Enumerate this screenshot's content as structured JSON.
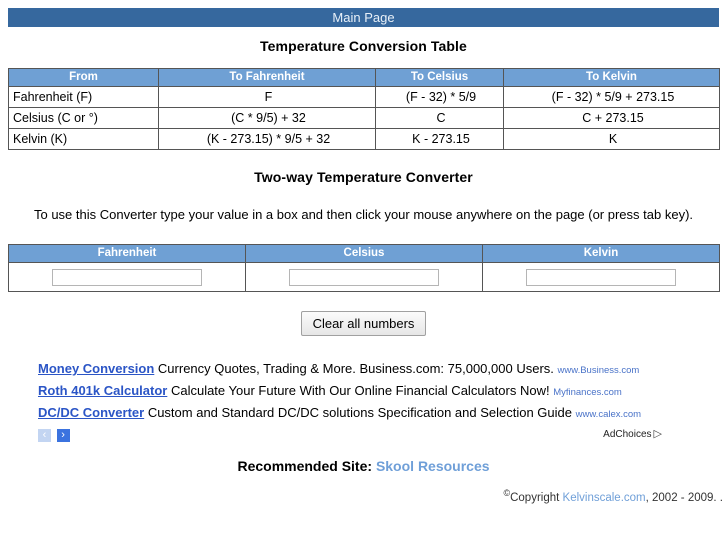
{
  "header": {
    "main_page_label": "Main Page",
    "bar_color": "#36689e"
  },
  "titles": {
    "conversion_table": "Temperature Conversion Table",
    "converter": "Two-way Temperature Converter"
  },
  "conversion_table": {
    "header_color": "#6fa0d4",
    "columns": [
      "From",
      "To Fahrenheit",
      "To Celsius",
      "To Kelvin"
    ],
    "rows": [
      {
        "from": "Fahrenheit (F)",
        "to_fahrenheit": "F",
        "to_celsius": "(F - 32) * 5/9",
        "to_kelvin": "(F - 32) * 5/9 + 273.15"
      },
      {
        "from": "Celsius (C or °)",
        "to_fahrenheit": "(C * 9/5) + 32",
        "to_celsius": "C",
        "to_kelvin": "C + 273.15"
      },
      {
        "from": "Kelvin (K)",
        "to_fahrenheit": "(K - 273.15) * 9/5 + 32",
        "to_celsius": "K - 273.15",
        "to_kelvin": "K"
      }
    ]
  },
  "converter": {
    "instruction": "To use this Converter type your value in a box and then click your mouse anywhere on the page (or press tab key).",
    "columns": [
      "Fahrenheit",
      "Celsius",
      "Kelvin"
    ],
    "fields": [
      {
        "label": "Fahrenheit",
        "value": "",
        "placeholder": ""
      },
      {
        "label": "Celsius",
        "value": "",
        "placeholder": ""
      },
      {
        "label": "Kelvin",
        "value": "",
        "placeholder": ""
      }
    ],
    "clear_button": "Clear all numbers"
  },
  "ads": {
    "items": [
      {
        "title": "Money Conversion",
        "description": "Currency Quotes, Trading & More. Business.com: 75,000,000 Users.",
        "url": "www.Business.com"
      },
      {
        "title": "Roth 401k Calculator",
        "description": "Calculate Your Future With Our Online Financial Calculators Now!",
        "url": "Myfinances.com"
      },
      {
        "title": "DC/DC Converter",
        "description": "Custom and Standard DC/DC solutions Specification and Selection Guide",
        "url": "www.calex.com"
      }
    ],
    "prev_arrow": "‹",
    "next_arrow": "›",
    "adchoices_label": "AdChoices",
    "adchoices_icon": "▷"
  },
  "footer": {
    "recommended_label": "Recommended Site:",
    "recommended_link": "Skool Resources",
    "copyright_symbol": "©",
    "copyright_word": "Copyright",
    "copyright_site": "Kelvinscale.com",
    "copyright_years": ", 2002 - 2009. ."
  }
}
